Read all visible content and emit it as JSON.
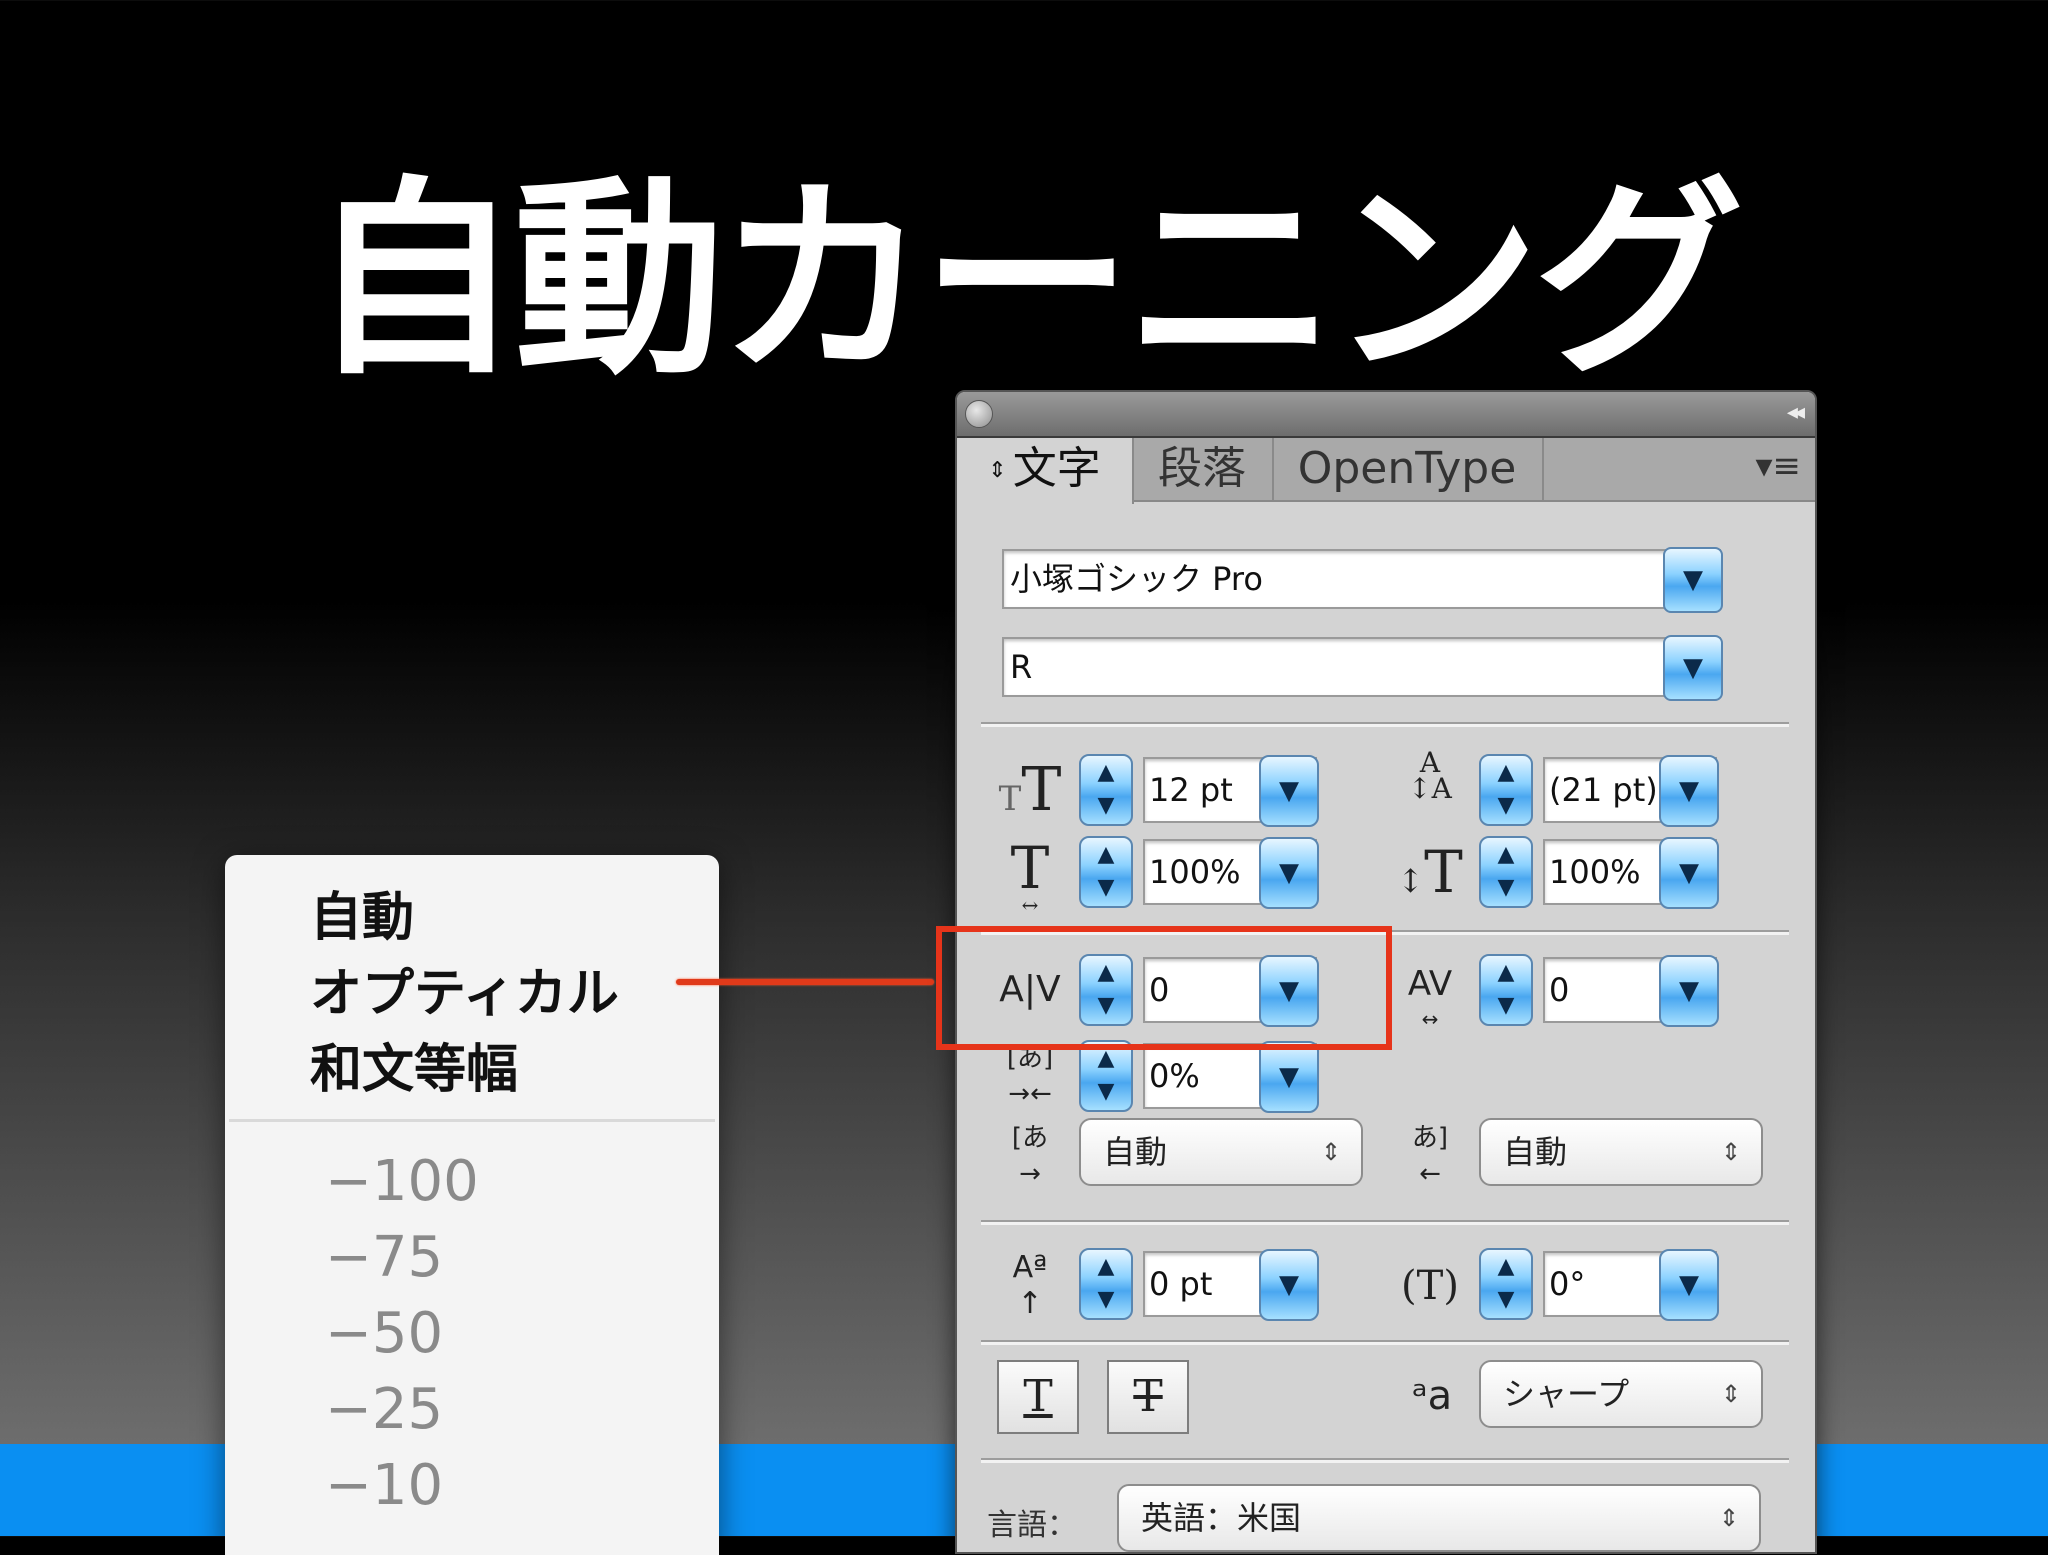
{
  "slide": {
    "title": "自動カーニング"
  },
  "menu": {
    "items": [
      "自動",
      "オプティカル",
      "和文等幅"
    ],
    "numbers": [
      "−100",
      "−75",
      "−50",
      "−25",
      "−10"
    ]
  },
  "panel": {
    "tabs": {
      "moji": "文字",
      "danraku": "段落",
      "opentype": "OpenType"
    },
    "font_family": "小塚ゴシック Pro",
    "font_style": "R",
    "font_size": "12 pt",
    "leading": "(21 pt)",
    "vertical_scale": "100%",
    "horizontal_scale": "100%",
    "kerning": "0",
    "tracking": "0",
    "tsume": "0%",
    "aki_left": "自動",
    "aki_right": "自動",
    "baseline_shift": "0 pt",
    "rotation": "0°",
    "antialias": "シャープ",
    "language_label": "言語：",
    "language": "英語：米国"
  },
  "colors": {
    "accent_band": "#0a8ff2",
    "highlight": "#e6341a",
    "spinner_blue": "#4aa7f0"
  },
  "icons": {
    "font_size": "font-size-icon",
    "leading": "leading-icon",
    "vertical_scale": "vertical-scale-icon",
    "horizontal_scale": "horizontal-scale-icon",
    "kerning": "kerning-icon",
    "tracking": "tracking-icon",
    "tsume": "tsume-icon",
    "aki_left": "aki-left-icon",
    "aki_right": "aki-right-icon",
    "baseline_shift": "baseline-shift-icon",
    "rotation": "character-rotation-icon",
    "antialias": "antialias-icon"
  }
}
